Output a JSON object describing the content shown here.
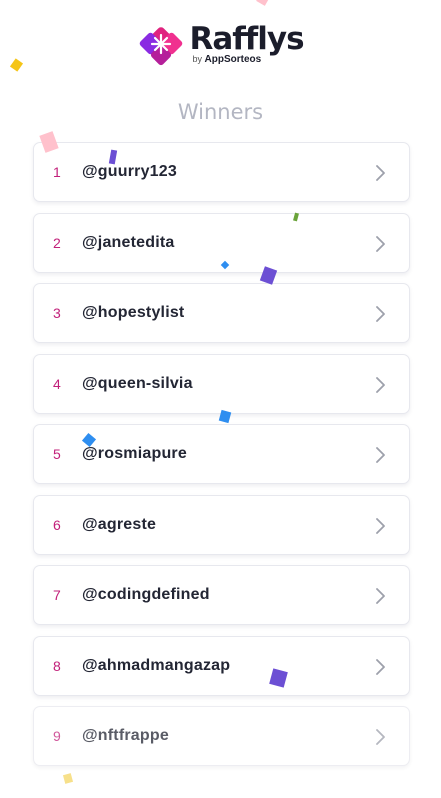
{
  "brand": {
    "name": "Rafflys",
    "by": "by",
    "company": "AppSorteos"
  },
  "title": "Winners",
  "winners": [
    {
      "rank": "1",
      "handle": "@guurry123"
    },
    {
      "rank": "2",
      "handle": "@janetedita"
    },
    {
      "rank": "3",
      "handle": "@hopestylist"
    },
    {
      "rank": "4",
      "handle": "@queen-silvia"
    },
    {
      "rank": "5",
      "handle": "@rosmiapure"
    },
    {
      "rank": "6",
      "handle": "@agreste"
    },
    {
      "rank": "7",
      "handle": "@codingdefined"
    },
    {
      "rank": "8",
      "handle": "@ahmadmangazap"
    },
    {
      "rank": "9",
      "handle": "@nftfrappe"
    }
  ],
  "colors": {
    "brand": "#c2207a",
    "confetti": [
      "#ffc1cc",
      "#f5c518",
      "#6c4fd4",
      "#2e8ef0",
      "#6aa33a",
      "#f7e08a"
    ]
  },
  "icons": {
    "row_action": "chevron-right-icon",
    "logo": "diamond-logo-icon"
  }
}
